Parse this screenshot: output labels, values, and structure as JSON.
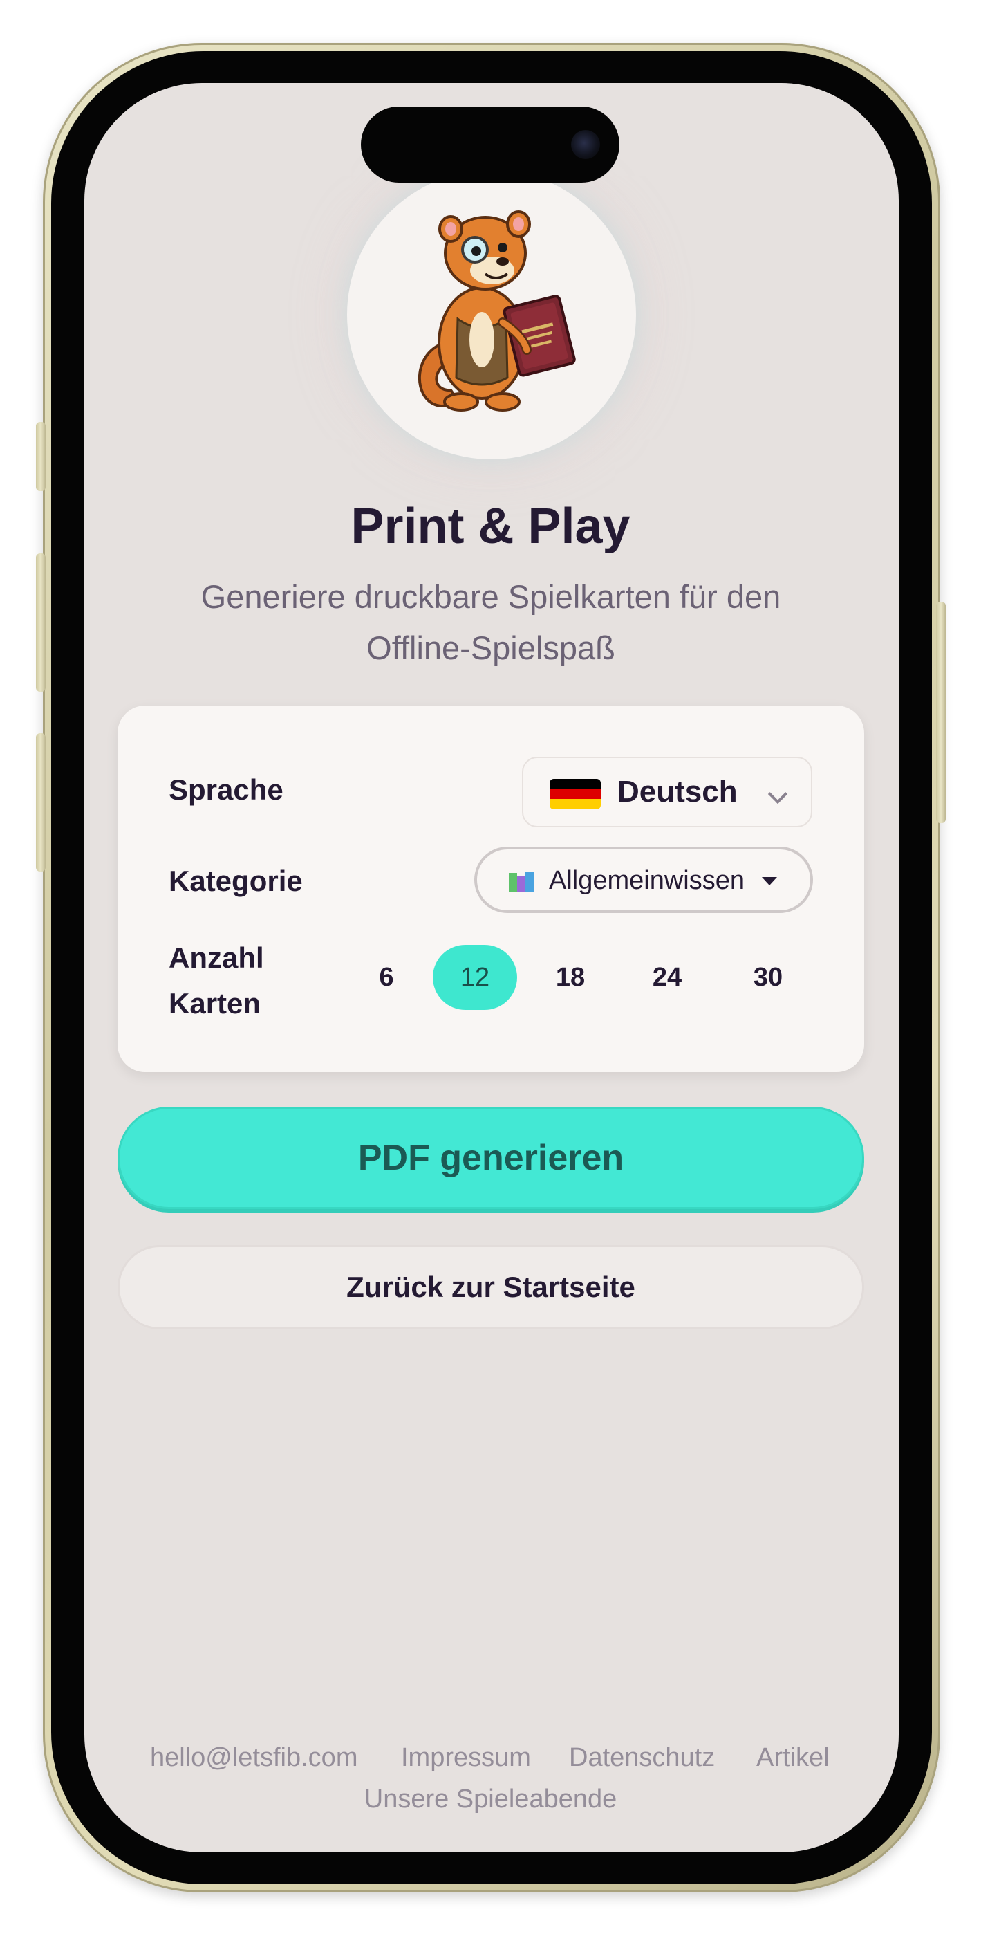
{
  "header": {
    "title": "Print & Play",
    "subtitle": "Generiere druckbare Spielkarten für den Offline-Spielspaß"
  },
  "settings": {
    "language_label": "Sprache",
    "language_value": "Deutsch",
    "category_label": "Kategorie",
    "category_value": "Allgemeinwissen",
    "count_label_line1": "Anzahl",
    "count_label_line2": "Karten",
    "count_options": [
      "6",
      "12",
      "18",
      "24",
      "30"
    ],
    "count_selected": "12"
  },
  "actions": {
    "generate_label": "PDF generieren",
    "back_label": "Zurück zur Startseite"
  },
  "footer": {
    "email": "hello@letsfib.com",
    "impressum": "Impressum",
    "datenschutz": "Datenschutz",
    "artikel": "Artikel",
    "spieleabende": "Unsere Spieleabende"
  },
  "colors": {
    "accent": "#43e8d4",
    "background": "#e6e1df",
    "card": "#f9f6f4",
    "text": "#241a33"
  },
  "icons": {
    "mascot": "weasel-mascot-with-book",
    "flag": "germany-flag-icon",
    "category": "books-icon",
    "language_chevron": "chevron-down-icon",
    "category_caret": "caret-down-icon"
  }
}
